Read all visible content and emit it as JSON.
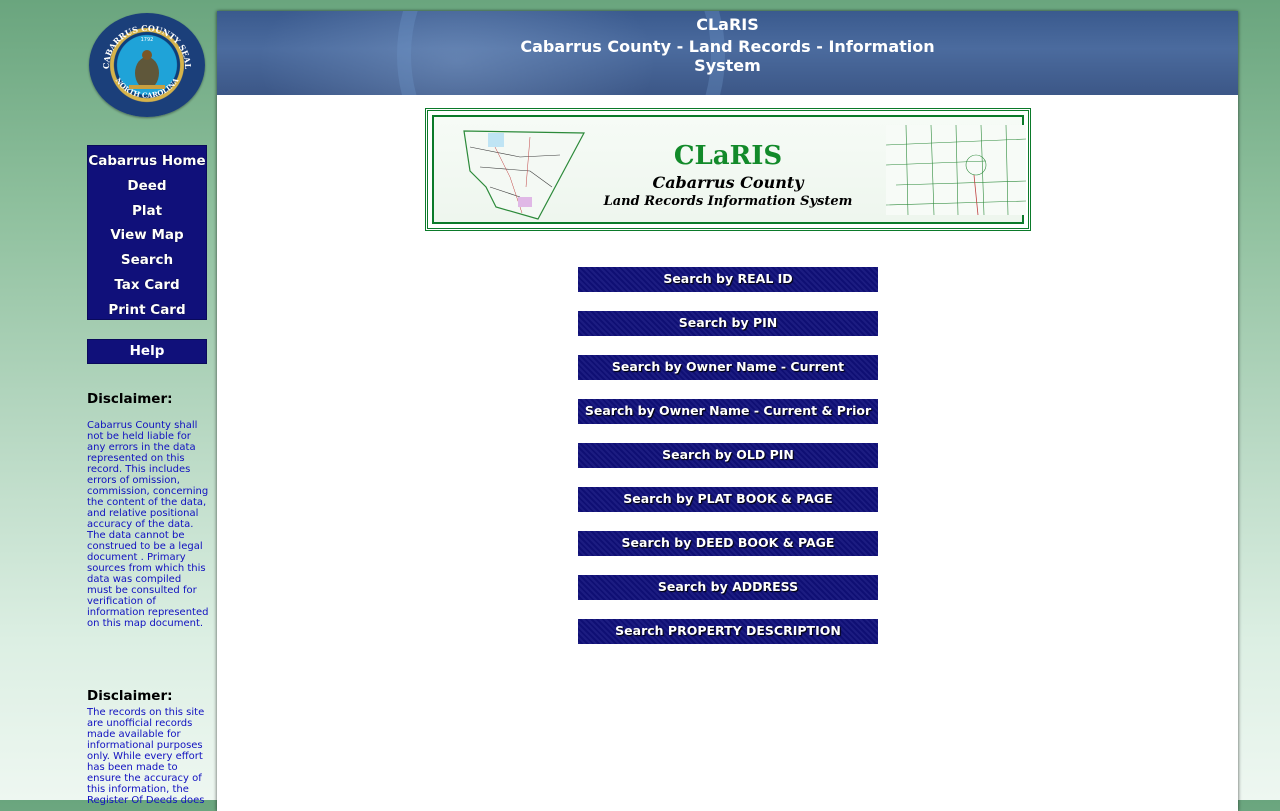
{
  "header": {
    "title": "CLaRIS",
    "subtitle_line1": "Cabarrus County - Land Records - Information",
    "subtitle_line2": "System"
  },
  "seal": {
    "top_text": "CABARRUS COUNTY SEAL",
    "bottom_text": "NORTH CAROLINA",
    "year": "1792"
  },
  "banner": {
    "title": "CLaRIS",
    "line2": "Cabarrus County",
    "line3": "Land Records Information System"
  },
  "nav": {
    "items": [
      {
        "label": "Cabarrus Home"
      },
      {
        "label": "Deed"
      },
      {
        "label": "Plat"
      },
      {
        "label": "View Map"
      },
      {
        "label": "Search"
      },
      {
        "label": "Tax Card"
      },
      {
        "label": "Print Card"
      }
    ],
    "help": "Help"
  },
  "disclaimers": [
    {
      "title": "Disclaimer:",
      "text": "Cabarrus County shall not be held liable for any errors in the data represented on this record. This includes errors of omission, commission, concerning the content of the data, and relative positional accuracy of the data. The data cannot be construed to be a legal document .  Primary sources from which this data was compiled must be consulted for verification of information represented on this map document."
    },
    {
      "title": "Disclaimer:",
      "text": "The records on this site are unofficial records made available for informational purposes only. While every effort has been made to ensure the accuracy of this information, the Register Of Deeds does"
    }
  ],
  "search_buttons": [
    {
      "label": "Search by REAL ID"
    },
    {
      "label": "Search by PIN"
    },
    {
      "label": "Search by Owner Name - Current"
    },
    {
      "label": "Search by Owner Name - Current & Prior"
    },
    {
      "label": "Search by OLD PIN"
    },
    {
      "label": "Search by PLAT BOOK & PAGE"
    },
    {
      "label": "Search by DEED BOOK & PAGE"
    },
    {
      "label": "Search by ADDRESS"
    },
    {
      "label": "Search PROPERTY DESCRIPTION"
    }
  ],
  "colors": {
    "nav_bg": "#10107a",
    "header_bg": "#3c5787",
    "banner_green": "#0b7a2a",
    "disclaimer_text": "#1010c0"
  }
}
